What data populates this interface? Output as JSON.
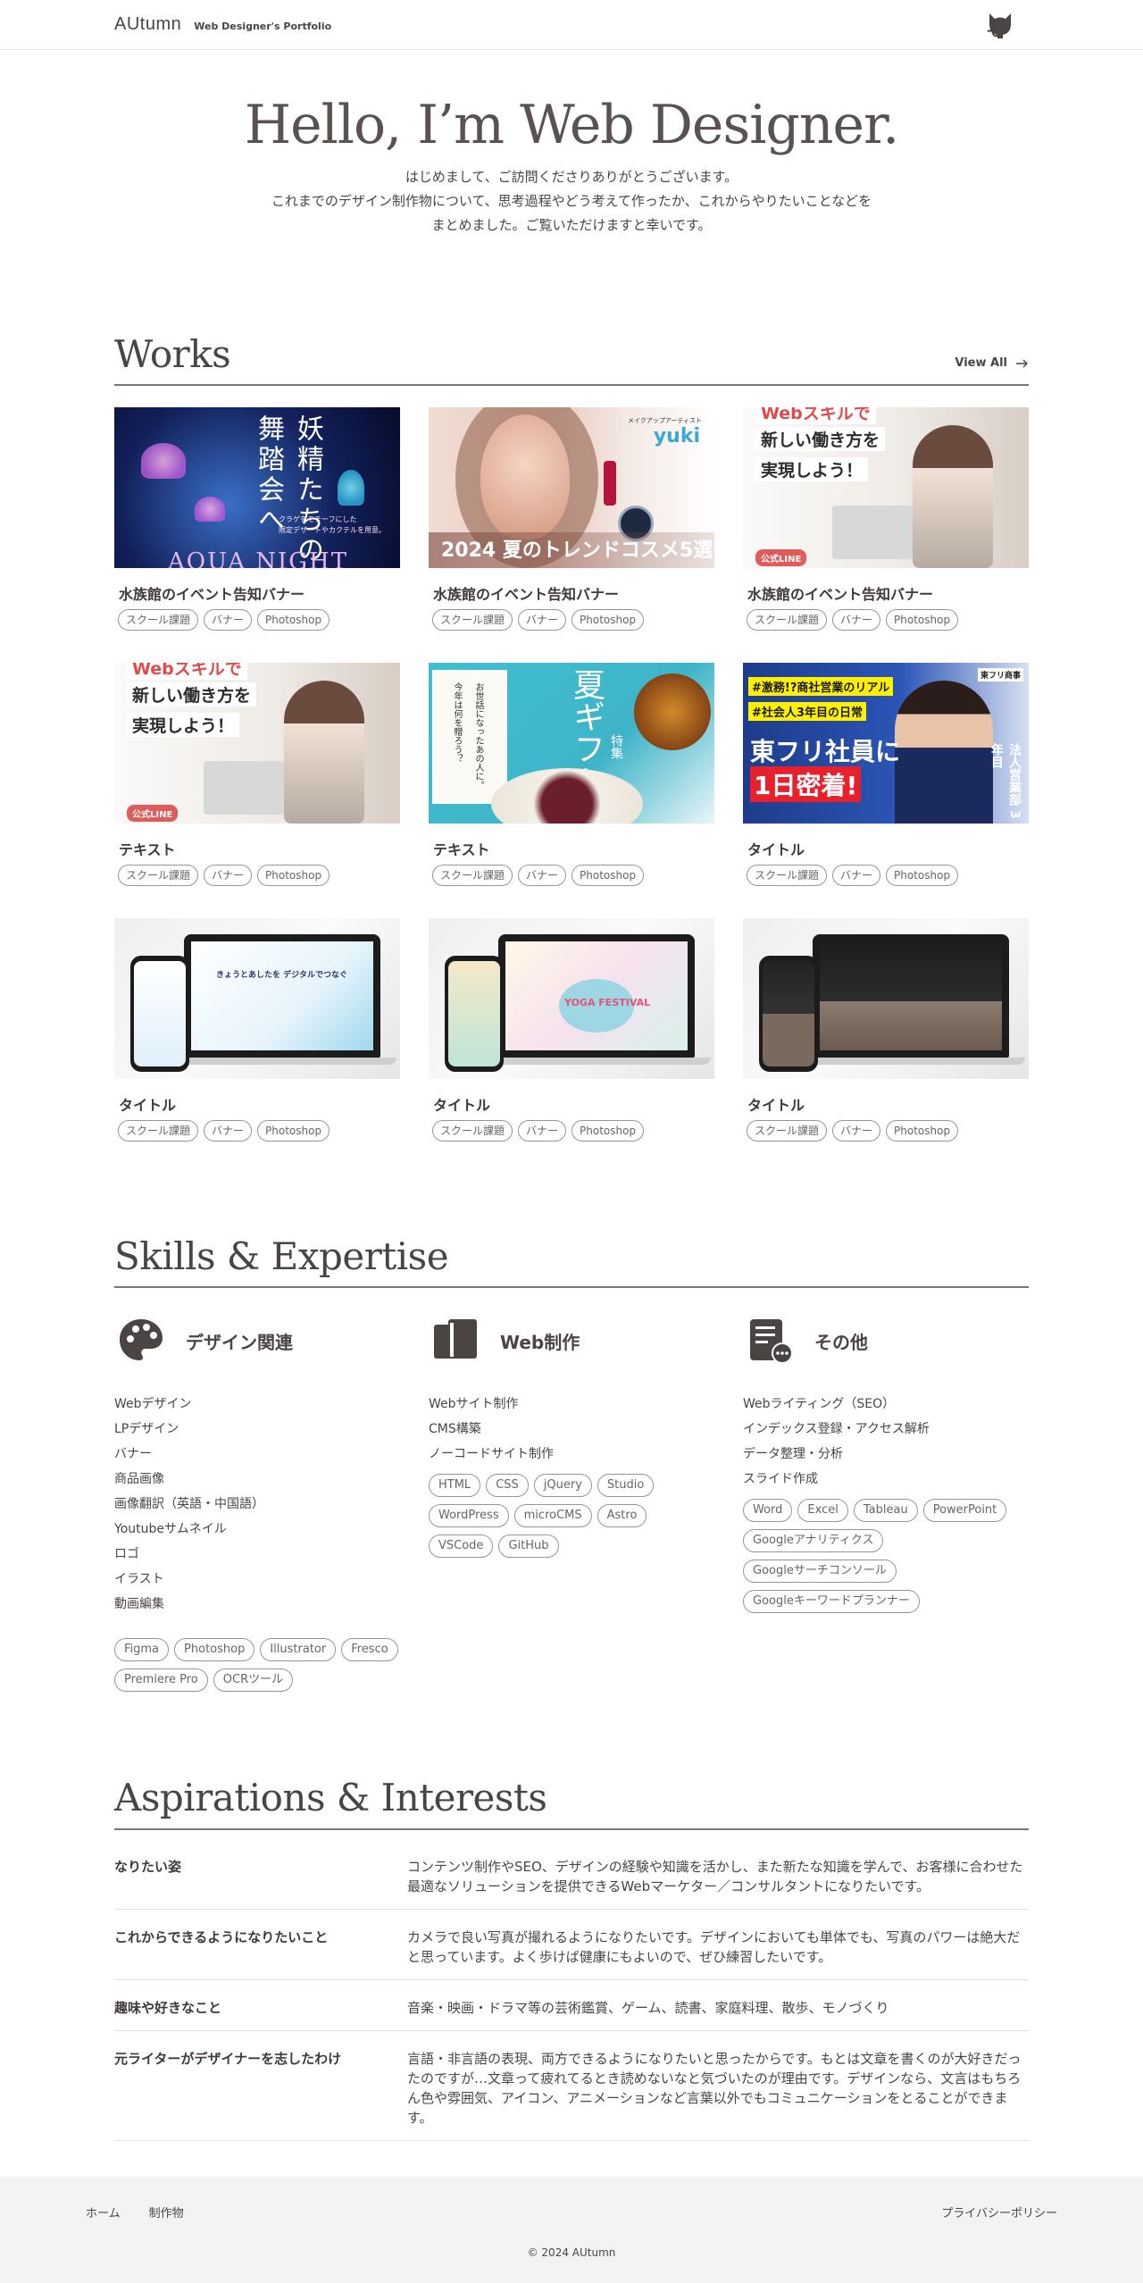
{
  "header": {
    "logo": "AUtumn",
    "subtitle": "Web Designer's Portfolio",
    "icon": "github-cat-icon"
  },
  "hero": {
    "title": "Hello, I’m Web Designer.",
    "lines": [
      "はじめまして、ご訪問くださりありがとうございます。",
      "これまでのデザイン制作物について、思考過程やどう考えて作ったか、これからやりたいことなどを",
      "まとめました。ご覧いただけますと幸いです。"
    ]
  },
  "works": {
    "title": "Works",
    "view_all": "View All",
    "items": [
      {
        "title": "水族館のイベント告知バナー",
        "tags": [
          "スクール課題",
          "バナー",
          "Photoshop"
        ],
        "image": {
          "vertical": "妖精たちの舞踏会へ",
          "caption1": "クラゲをモチーフにした",
          "caption2": "限定デザートやカクテルを用意。",
          "big": "AQUA NIGHT"
        }
      },
      {
        "title": "水族館のイベント告知バナー",
        "tags": [
          "スクール課題",
          "バナー",
          "Photoshop"
        ],
        "image": {
          "band": "2024 夏のトレンドコスメ5選",
          "artist_label": "メイクアップアーティスト",
          "artist": "yuki"
        }
      },
      {
        "title": "水族館のイベント告知バナー",
        "tags": [
          "スクール課題",
          "バナー",
          "Photoshop"
        ],
        "image": {
          "line1": "Webスキルで",
          "line2": "新しい働き方を",
          "line3": "実現しよう！",
          "badge": "公式LINE"
        }
      },
      {
        "title": "テキスト",
        "tags": [
          "スクール課題",
          "バナー",
          "Photoshop"
        ],
        "image": {
          "line1": "Webスキルで",
          "line2": "新しい働き方を",
          "line3": "実現しよう！",
          "badge": "公式LINE"
        }
      },
      {
        "title": "テキスト",
        "tags": [
          "スクール課題",
          "バナー",
          "Photoshop"
        ],
        "image": {
          "vert1": "お世話になったあの人に。",
          "vert2": "今年は何を贈ろう？",
          "kanji": "夏ギフト",
          "sub": "特集"
        }
      },
      {
        "title": "タイトル",
        "tags": [
          "スクール課題",
          "バナー",
          "Photoshop"
        ],
        "image": {
          "hl1": "#激務!?商社営業のリアル",
          "hl2": "#社会人3年目の日常",
          "big1": "東フリ社員に",
          "big2": "1日密着!",
          "vert": "法人営業部 3年目",
          "logo": "東フリ商事"
        }
      },
      {
        "title": "タイトル",
        "tags": [
          "スクール課題",
          "バナー",
          "Photoshop"
        ],
        "image": {
          "screen": "きょうとあしたを デジタルでつなぐ",
          "scheme": "blue"
        }
      },
      {
        "title": "タイトル",
        "tags": [
          "スクール課題",
          "バナー",
          "Photoshop"
        ],
        "image": {
          "screen": "YOGA FESTIVAL",
          "scheme": "pastel"
        }
      },
      {
        "title": "タイトル",
        "tags": [
          "スクール課題",
          "バナー",
          "Photoshop"
        ],
        "image": {
          "screen": "",
          "scheme": "dark"
        }
      }
    ]
  },
  "skills": {
    "title": "Skills & Expertise",
    "columns": [
      {
        "name": "デザイン関連",
        "icon": "palette-icon",
        "items": [
          "Webデザイン",
          "LPデザイン",
          "バナー",
          "商品画像",
          "画像翻訳（英語・中国語）",
          "Youtubeサムネイル",
          "ロゴ",
          "イラスト",
          "動画編集"
        ],
        "tags": [
          "Figma",
          "Photoshop",
          "Illustrator",
          "Fresco",
          "Premiere Pro",
          "OCRツール"
        ]
      },
      {
        "name": "Web制作",
        "icon": "devices-icon",
        "items": [
          "Webサイト制作",
          "CMS構築",
          "ノーコードサイト制作"
        ],
        "tags": [
          "HTML",
          "CSS",
          "jQuery",
          "Studio",
          "WordPress",
          "microCMS",
          "Astro",
          "VSCode",
          "GitHub"
        ]
      },
      {
        "name": "その他",
        "icon": "document-more-icon",
        "items": [
          "Webライティング（SEO）",
          "インデックス登録・アクセス解析",
          "データ整理・分析",
          "スライド作成"
        ],
        "tags": [
          "Word",
          "Excel",
          "Tableau",
          "PowerPoint",
          "Googleアナリティクス",
          "Googleサーチコンソール",
          "Googleキーワードプランナー"
        ]
      }
    ]
  },
  "aspirations": {
    "title": "Aspirations & Interests",
    "rows": [
      {
        "key": "なりたい姿",
        "value": "コンテンツ制作やSEO、デザインの経験や知識を活かし、また新たな知識を学んで、お客様に合わせた最適なソリューションを提供できるWebマーケター／コンサルタントになりたいです。"
      },
      {
        "key": "これからできるようになりたいこと",
        "value": "カメラで良い写真が撮れるようになりたいです。デザインにおいても単体でも、写真のパワーは絶大だと思っています。よく歩けば健康にもよいので、ぜひ練習したいです。"
      },
      {
        "key": "趣味や好きなこと",
        "value": "音楽・映画・ドラマ等の芸術鑑賞、ゲーム、読書、家庭料理、散歩、モノづくり"
      },
      {
        "key": "元ライターがデザイナーを志したわけ",
        "value": "言語・非言語の表現、両方できるようになりたいと思ったからです。もとは文章を書くのが大好きだったのですが…文章って疲れてるとき読めないなと気づいたのが理由です。デザインなら、文言はもちろん色や雰囲気、アイコン、アニメーションなど言葉以外でもコミュニケーションをとることができます。"
      }
    ]
  },
  "footer": {
    "home": "ホーム",
    "works": "制作物",
    "privacy": "プライバシーポリシー",
    "copyright": "© 2024 AUtumn"
  }
}
